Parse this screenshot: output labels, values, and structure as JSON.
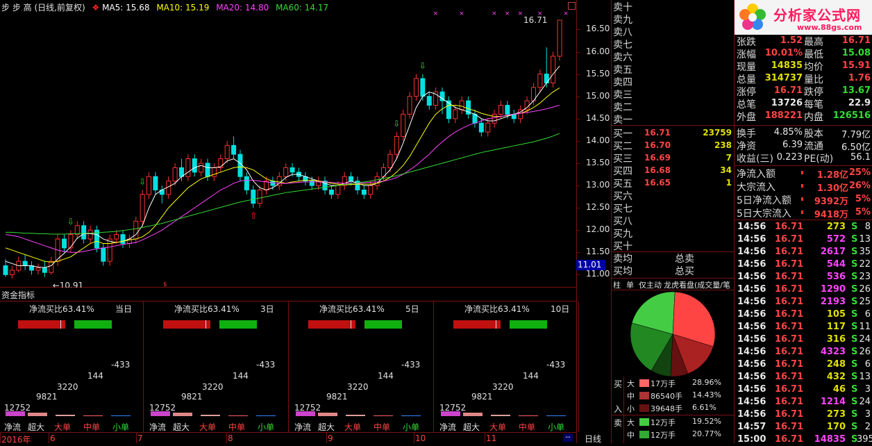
{
  "header": {
    "stock_name": "步 步 高",
    "mode": "(日线,前复权)",
    "ma5": "MA5: 15.68",
    "ma10": "MA10: 15.19",
    "ma20": "MA20: 14.80",
    "ma60": "MA60: 14.17",
    "colors": {
      "ma5": "#ffffff",
      "ma10": "#ffff00",
      "ma20": "#ff44ff",
      "ma60": "#33dd33"
    }
  },
  "chart_data": {
    "type": "candlestick",
    "y_ticks": [
      "16.50",
      "16.00",
      "15.50",
      "15.00",
      "14.50",
      "14.00",
      "13.50",
      "13.00",
      "12.50",
      "12.00",
      "11.50",
      "11.00"
    ],
    "ylim": [
      10.85,
      16.85
    ],
    "current_price_label": "11.01",
    "high_label": "16.71",
    "low_label": "10.91",
    "x_labels": [
      "2016年",
      "6",
      "7",
      "8",
      "9",
      "10",
      "11"
    ],
    "period_label": "日线",
    "candles": [
      [
        11.2,
        11.0,
        11.35,
        10.95
      ],
      [
        11.0,
        11.1,
        11.2,
        10.91
      ],
      [
        11.1,
        11.3,
        11.4,
        11.05
      ],
      [
        11.3,
        11.2,
        11.45,
        11.1
      ],
      [
        11.2,
        11.1,
        11.3,
        11.0
      ],
      [
        11.1,
        11.15,
        11.25,
        11.0
      ],
      [
        11.15,
        11.05,
        11.3,
        10.95
      ],
      [
        11.05,
        11.3,
        11.4,
        11.0
      ],
      [
        11.3,
        11.8,
        11.9,
        11.2
      ],
      [
        11.8,
        11.6,
        11.9,
        11.5
      ],
      [
        11.6,
        11.9,
        12.0,
        11.5
      ],
      [
        11.9,
        12.1,
        12.2,
        11.8
      ],
      [
        12.1,
        11.8,
        12.2,
        11.7
      ],
      [
        11.8,
        12.0,
        12.1,
        11.7
      ],
      [
        12.0,
        11.6,
        12.1,
        11.5
      ],
      [
        11.6,
        11.3,
        11.7,
        11.2
      ],
      [
        11.3,
        11.8,
        11.9,
        11.2
      ],
      [
        11.8,
        11.9,
        12.0,
        11.7
      ],
      [
        11.9,
        11.7,
        12.0,
        11.6
      ],
      [
        11.7,
        11.8,
        11.9,
        11.6
      ],
      [
        11.8,
        12.2,
        12.3,
        11.7
      ],
      [
        12.2,
        12.8,
        12.9,
        12.1
      ],
      [
        12.8,
        13.2,
        13.3,
        12.7
      ],
      [
        13.2,
        12.9,
        13.3,
        12.8
      ],
      [
        12.9,
        12.8,
        13.0,
        12.6
      ],
      [
        12.8,
        13.1,
        13.2,
        12.7
      ],
      [
        13.1,
        13.4,
        13.5,
        13.0
      ],
      [
        13.4,
        13.2,
        13.6,
        13.1
      ],
      [
        13.2,
        13.6,
        13.7,
        13.1
      ],
      [
        13.6,
        13.3,
        13.7,
        13.2
      ],
      [
        13.3,
        13.5,
        13.6,
        13.2
      ],
      [
        13.5,
        13.2,
        13.6,
        13.1
      ],
      [
        13.2,
        13.4,
        13.5,
        13.1
      ],
      [
        13.4,
        13.6,
        13.7,
        13.3
      ],
      [
        13.6,
        13.9,
        14.0,
        13.5
      ],
      [
        13.9,
        13.7,
        14.1,
        13.6
      ],
      [
        13.7,
        13.2,
        13.8,
        13.1
      ],
      [
        13.2,
        12.9,
        13.3,
        12.8
      ],
      [
        12.9,
        12.6,
        13.0,
        12.5
      ],
      [
        12.6,
        12.9,
        13.0,
        12.5
      ],
      [
        12.9,
        13.1,
        13.2,
        12.8
      ],
      [
        13.1,
        13.0,
        13.2,
        12.9
      ],
      [
        13.0,
        13.2,
        13.3,
        12.9
      ],
      [
        13.2,
        13.4,
        13.5,
        13.1
      ],
      [
        13.4,
        13.3,
        13.5,
        13.2
      ],
      [
        13.3,
        13.2,
        13.4,
        13.1
      ],
      [
        13.2,
        13.1,
        13.3,
        13.0
      ],
      [
        13.1,
        13.0,
        13.2,
        12.9
      ],
      [
        13.0,
        13.1,
        13.2,
        12.9
      ],
      [
        13.1,
        12.9,
        13.2,
        12.8
      ],
      [
        12.9,
        12.8,
        13.0,
        12.7
      ],
      [
        12.8,
        13.0,
        13.1,
        12.7
      ],
      [
        13.0,
        13.2,
        13.3,
        12.9
      ],
      [
        13.2,
        13.1,
        13.3,
        13.0
      ],
      [
        13.1,
        12.9,
        13.2,
        12.8
      ],
      [
        12.9,
        12.8,
        13.0,
        12.7
      ],
      [
        12.8,
        13.0,
        13.1,
        12.7
      ],
      [
        13.0,
        13.2,
        13.3,
        12.9
      ],
      [
        13.2,
        13.4,
        13.5,
        13.1
      ],
      [
        13.4,
        13.7,
        13.8,
        13.3
      ],
      [
        13.7,
        14.1,
        14.2,
        13.6
      ],
      [
        14.1,
        14.6,
        14.7,
        14.0
      ],
      [
        14.6,
        15.0,
        15.1,
        14.5
      ],
      [
        15.0,
        15.4,
        15.5,
        14.9
      ],
      [
        15.4,
        15.0,
        15.5,
        14.9
      ],
      [
        15.0,
        14.8,
        15.1,
        14.7
      ],
      [
        14.8,
        15.1,
        15.2,
        14.7
      ],
      [
        15.1,
        14.9,
        15.2,
        14.6
      ],
      [
        14.9,
        14.5,
        15.0,
        14.4
      ],
      [
        14.5,
        14.7,
        14.8,
        14.4
      ],
      [
        14.7,
        14.9,
        15.0,
        14.6
      ],
      [
        14.9,
        14.6,
        15.0,
        14.5
      ],
      [
        14.6,
        14.4,
        14.7,
        14.3
      ],
      [
        14.4,
        14.2,
        14.5,
        14.1
      ],
      [
        14.2,
        14.4,
        14.5,
        14.1
      ],
      [
        14.4,
        14.6,
        14.7,
        14.3
      ],
      [
        14.6,
        14.8,
        14.9,
        14.5
      ],
      [
        14.8,
        14.6,
        14.9,
        14.5
      ],
      [
        14.6,
        14.5,
        14.7,
        14.4
      ],
      [
        14.5,
        14.7,
        14.8,
        14.4
      ],
      [
        14.7,
        14.9,
        15.0,
        14.6
      ],
      [
        14.9,
        15.2,
        15.3,
        14.8
      ],
      [
        15.2,
        15.5,
        15.6,
        15.1
      ],
      [
        15.5,
        15.3,
        16.1,
        15.2
      ],
      [
        15.3,
        15.9,
        16.0,
        15.2
      ],
      [
        15.9,
        16.71,
        16.71,
        15.8
      ]
    ],
    "ma_series": {
      "ma5": [
        11.3,
        11.25,
        11.2,
        11.2,
        11.2,
        11.17,
        11.16,
        11.2,
        11.35,
        11.48,
        11.62,
        11.82,
        11.92,
        11.92,
        11.9,
        11.8,
        11.75,
        11.72,
        11.75,
        11.8,
        11.9,
        12.1,
        12.5,
        12.8,
        12.9,
        12.97,
        13.05,
        13.2,
        13.3,
        13.4,
        13.45,
        13.4,
        13.4,
        13.42,
        13.55,
        13.6,
        13.5,
        13.35,
        13.1,
        12.95,
        12.9,
        12.95,
        13.05,
        13.18,
        13.25,
        13.25,
        13.2,
        13.15,
        13.1,
        13.05,
        13.0,
        13.0,
        13.05,
        13.1,
        13.05,
        13.0,
        13.0,
        13.05,
        13.2,
        13.35,
        13.6,
        13.95,
        14.35,
        14.75,
        15.0,
        15.1,
        15.05,
        14.95,
        14.85,
        14.75,
        14.7,
        14.65,
        14.6,
        14.5,
        14.45,
        14.45,
        14.5,
        14.55,
        14.6,
        14.65,
        14.75,
        14.9,
        15.1,
        15.3,
        15.5,
        15.68
      ],
      "ma10": [
        11.6,
        11.55,
        11.5,
        11.45,
        11.4,
        11.35,
        11.3,
        11.28,
        11.3,
        11.35,
        11.4,
        11.5,
        11.6,
        11.7,
        11.75,
        11.7,
        11.7,
        11.72,
        11.75,
        11.78,
        11.8,
        11.85,
        11.95,
        12.1,
        12.3,
        12.5,
        12.65,
        12.8,
        12.95,
        13.05,
        13.15,
        13.2,
        13.25,
        13.3,
        13.35,
        13.4,
        13.42,
        13.4,
        13.35,
        13.25,
        13.15,
        13.1,
        13.08,
        13.05,
        13.08,
        13.1,
        13.12,
        13.12,
        13.1,
        13.08,
        13.05,
        13.03,
        13.02,
        13.02,
        13.03,
        13.03,
        13.03,
        13.05,
        13.1,
        13.18,
        13.3,
        13.45,
        13.65,
        13.9,
        14.15,
        14.4,
        14.6,
        14.72,
        14.8,
        14.8,
        14.78,
        14.72,
        14.68,
        14.62,
        14.58,
        14.55,
        14.55,
        14.57,
        14.6,
        14.62,
        14.67,
        14.75,
        14.85,
        14.98,
        15.1,
        15.19
      ],
      "ma20": [
        11.9,
        11.88,
        11.85,
        11.8,
        11.75,
        11.7,
        11.65,
        11.6,
        11.55,
        11.52,
        11.5,
        11.5,
        11.52,
        11.55,
        11.58,
        11.6,
        11.62,
        11.65,
        11.68,
        11.7,
        11.72,
        11.78,
        11.85,
        11.92,
        12.0,
        12.1,
        12.2,
        12.3,
        12.4,
        12.5,
        12.6,
        12.7,
        12.8,
        12.9,
        12.97,
        13.05,
        13.1,
        13.12,
        13.12,
        13.1,
        13.08,
        13.06,
        13.05,
        13.05,
        13.06,
        13.07,
        13.08,
        13.08,
        13.08,
        13.08,
        13.07,
        13.06,
        13.05,
        13.05,
        13.05,
        13.06,
        13.07,
        13.08,
        13.1,
        13.13,
        13.18,
        13.25,
        13.35,
        13.45,
        13.58,
        13.7,
        13.85,
        13.98,
        14.1,
        14.2,
        14.28,
        14.35,
        14.4,
        14.45,
        14.5,
        14.52,
        14.55,
        14.58,
        14.6,
        14.62,
        14.64,
        14.66,
        14.69,
        14.72,
        14.76,
        14.8
      ],
      "ma60": [
        11.95,
        11.95,
        11.94,
        11.93,
        11.93,
        11.92,
        11.92,
        11.91,
        11.91,
        11.91,
        11.92,
        11.92,
        11.93,
        11.93,
        11.94,
        11.95,
        11.96,
        11.97,
        11.99,
        12.01,
        12.03,
        12.06,
        12.09,
        12.12,
        12.15,
        12.19,
        12.23,
        12.27,
        12.31,
        12.35,
        12.39,
        12.43,
        12.47,
        12.51,
        12.55,
        12.59,
        12.63,
        12.66,
        12.69,
        12.72,
        12.75,
        12.78,
        12.81,
        12.84,
        12.86,
        12.88,
        12.9,
        12.92,
        12.94,
        12.96,
        12.98,
        13.0,
        13.02,
        13.04,
        13.06,
        13.08,
        13.1,
        13.13,
        13.16,
        13.19,
        13.22,
        13.26,
        13.3,
        13.34,
        13.38,
        13.42,
        13.46,
        13.5,
        13.54,
        13.58,
        13.62,
        13.66,
        13.7,
        13.74,
        13.77,
        13.8,
        13.83,
        13.86,
        13.89,
        13.92,
        13.95,
        13.98,
        14.02,
        14.06,
        14.11,
        14.17
      ]
    }
  },
  "fund": {
    "section_label": "资金指标",
    "panels": [
      {
        "title": "净流买比63.41%",
        "period": "当日"
      },
      {
        "title": "净流买比63.41%",
        "period": "3日"
      },
      {
        "title": "净流买比63.41%",
        "period": "5日"
      },
      {
        "title": "净流买比63.41%",
        "period": "10日"
      }
    ],
    "values": [
      "12752",
      "9821",
      "3220",
      "144",
      "-433"
    ],
    "categories": [
      "净流",
      "超大",
      "大单",
      "中单",
      "小单"
    ],
    "bar_colors": [
      "#cc44cc",
      "#e08888",
      "#e0a0a0",
      "#ff6060",
      "#3388ff"
    ],
    "cat_colors": [
      "#e0e0e0",
      "#e0e0e0",
      "#ff4444",
      "#ff4444",
      "#33dd33"
    ],
    "ratio_red": 0.5,
    "ratio_green": 0.4
  },
  "sell_levels": [
    "卖十",
    "卖九",
    "卖八",
    "卖七",
    "卖六",
    "卖五",
    "卖四",
    "卖三",
    "卖二",
    "卖一"
  ],
  "buy_levels": [
    {
      "label": "买一",
      "price": "16.71",
      "vol": "23759"
    },
    {
      "label": "买二",
      "price": "16.70",
      "vol": "238"
    },
    {
      "label": "买三",
      "price": "16.69",
      "vol": "7"
    },
    {
      "label": "买四",
      "price": "16.68",
      "vol": "34"
    },
    {
      "label": "买五",
      "price": "16.65",
      "vol": "1"
    },
    {
      "label": "买六",
      "price": "",
      "vol": ""
    },
    {
      "label": "买七",
      "price": "",
      "vol": ""
    },
    {
      "label": "买八",
      "price": "",
      "vol": ""
    },
    {
      "label": "买九",
      "price": "",
      "vol": ""
    },
    {
      "label": "买十",
      "price": "",
      "vol": ""
    }
  ],
  "avg": {
    "sell_avg": "卖均",
    "buy_avg": "买均",
    "total_sell": "总卖",
    "total_buy": "总买"
  },
  "order_tabs": [
    "柱",
    "单",
    "仅主动",
    "龙虎看盘(成交量/笔"
  ],
  "pie": {
    "slices": [
      {
        "label": "大",
        "value": "17万手",
        "pct": "28.96%",
        "color": "#ff4444",
        "share": 0.2896
      },
      {
        "label": "中",
        "value": "86540手",
        "pct": "14.43%",
        "color": "#aa2222",
        "share": 0.1443
      },
      {
        "label": "小",
        "value": "39648手",
        "pct": "6.61%",
        "color": "#661111",
        "share": 0.0661
      },
      {
        "label": "小",
        "value": "",
        "pct": "",
        "color": "#114411",
        "share": 0.0768
      },
      {
        "label": "中",
        "value": "",
        "pct": "",
        "color": "#228822",
        "share": 0.2077
      },
      {
        "label": "大",
        "value": "12万手",
        "pct": "19.52%",
        "color": "#44cc44",
        "share": 0.2155
      }
    ],
    "buy_label": "买",
    "in_label": "入",
    "sell_label": "卖",
    "legend": [
      {
        "side": "买",
        "size": "大",
        "value": "17万手",
        "pct": "28.96%",
        "color": "#ff6666"
      },
      {
        "side": "",
        "size": "中",
        "value": "86540手",
        "pct": "14.43%",
        "color": "#aa3333"
      },
      {
        "side": "入",
        "size": "小",
        "value": "39648手",
        "pct": "6.61%",
        "color": "#661111"
      },
      {
        "side": "卖",
        "size": "大",
        "value": "12万手",
        "pct": "19.52%",
        "color": "#44cc44"
      },
      {
        "side": "",
        "size": "中",
        "value": "12万手",
        "pct": "20.77%",
        "color": "#33aa33"
      }
    ]
  },
  "logo": {
    "title": "分析家公式网",
    "url": "www.88gs.com"
  },
  "quote": {
    "rows_top": [
      {
        "l1": "张跌",
        "v1": "1.52",
        "c1": "red",
        "l2": "最高",
        "v2": "16.71",
        "c2": "red"
      },
      {
        "l1": "涨幅",
        "v1": "10.01%",
        "c1": "red",
        "l2": "最低",
        "v2": "15.08",
        "c2": "green"
      },
      {
        "l1": "现量",
        "v1": "14835",
        "c1": "yellow",
        "l2": "均价",
        "v2": "15.91",
        "c2": "red"
      },
      {
        "l1": "总量",
        "v1": "314737",
        "c1": "yellow",
        "l2": "量比",
        "v2": "1.76",
        "c2": "red"
      },
      {
        "l1": "涨停",
        "v1": "16.71",
        "c1": "red",
        "l2": "跌停",
        "v2": "13.67",
        "c2": "green"
      },
      {
        "l1": "总笔",
        "v1": "13726",
        "c1": "white",
        "l2": "每笔",
        "v2": "22.9",
        "c2": "white"
      },
      {
        "l1": "外盘",
        "v1": "188221",
        "c1": "red",
        "l2": "内盘",
        "v2": "126516",
        "c2": "green"
      }
    ],
    "rows_mid": [
      {
        "l1": "换手",
        "v1": "4.85%",
        "c1": "white",
        "l2": "股本",
        "v2": "7.79亿",
        "c2": "white"
      },
      {
        "l1": "净资",
        "v1": "6.39",
        "c1": "white",
        "l2": "流通",
        "v2": "6.50亿",
        "c2": "white"
      },
      {
        "l1": "收益(三)",
        "v1": "0.223",
        "c1": "white",
        "l2": "PE(动)",
        "v2": "56.1",
        "c2": "white"
      }
    ],
    "flows": [
      {
        "l": "净流入额",
        "v": "1.28亿",
        "p": "25%"
      },
      {
        "l": "大宗流入",
        "v": "1.30亿",
        "p": "26%"
      },
      {
        "l": "5日净流入额",
        "v": "9392万",
        "p": "5%"
      },
      {
        "l": "5日大宗流入",
        "v": "9418万",
        "p": "5%"
      }
    ]
  },
  "ticks": [
    {
      "t": "14:56",
      "p": "16.71",
      "v": "273",
      "s": "S",
      "n": "8",
      "vc": "yellow"
    },
    {
      "t": "14:56",
      "p": "16.71",
      "v": "572",
      "s": "S",
      "n": "13",
      "vc": "magenta"
    },
    {
      "t": "14:56",
      "p": "16.71",
      "v": "2617",
      "s": "S",
      "n": "35",
      "vc": "magenta"
    },
    {
      "t": "14:56",
      "p": "16.71",
      "v": "544",
      "s": "S",
      "n": "22",
      "vc": "magenta"
    },
    {
      "t": "14:56",
      "p": "16.71",
      "v": "536",
      "s": "S",
      "n": "23",
      "vc": "magenta"
    },
    {
      "t": "14:56",
      "p": "16.71",
      "v": "1290",
      "s": "S",
      "n": "26",
      "vc": "magenta"
    },
    {
      "t": "14:56",
      "p": "16.71",
      "v": "2193",
      "s": "S",
      "n": "25",
      "vc": "magenta"
    },
    {
      "t": "14:56",
      "p": "16.71",
      "v": "105",
      "s": "S",
      "n": "6",
      "vc": "yellow"
    },
    {
      "t": "14:56",
      "p": "16.71",
      "v": "117",
      "s": "S",
      "n": "11",
      "vc": "yellow"
    },
    {
      "t": "14:56",
      "p": "16.71",
      "v": "316",
      "s": "S",
      "n": "24",
      "vc": "yellow"
    },
    {
      "t": "14:56",
      "p": "16.71",
      "v": "4323",
      "s": "S",
      "n": "26",
      "vc": "magenta"
    },
    {
      "t": "14:56",
      "p": "16.71",
      "v": "248",
      "s": "S",
      "n": "6",
      "vc": "yellow"
    },
    {
      "t": "14:56",
      "p": "16.71",
      "v": "432",
      "s": "S",
      "n": "13",
      "vc": "yellow"
    },
    {
      "t": "14:56",
      "p": "16.71",
      "v": "46",
      "s": "S",
      "n": "3",
      "vc": "yellow"
    },
    {
      "t": "14:56",
      "p": "16.71",
      "v": "1214",
      "s": "S",
      "n": "24",
      "vc": "magenta"
    },
    {
      "t": "14:56",
      "p": "16.71",
      "v": "273",
      "s": "S",
      "n": "3",
      "vc": "yellow"
    },
    {
      "t": "14:57",
      "p": "16.71",
      "v": "170",
      "s": "S",
      "n": "2",
      "vc": "yellow"
    },
    {
      "t": "15:00",
      "p": "16.71",
      "v": "14835",
      "s": "S",
      "n": "395",
      "vc": "magenta"
    }
  ]
}
